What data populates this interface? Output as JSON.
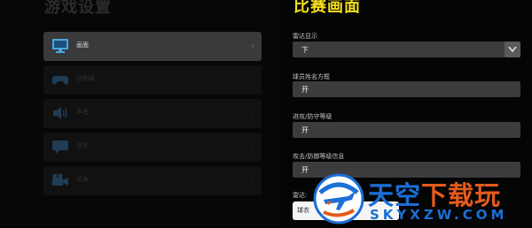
{
  "left_panel": {
    "title": "游戏设置",
    "items": [
      {
        "label": "画面",
        "icon": "monitor-icon",
        "active": true
      },
      {
        "label": "控制器",
        "icon": "gamepad-icon",
        "active": false
      },
      {
        "label": "声音",
        "icon": "speaker-icon",
        "active": false
      },
      {
        "label": "语言",
        "icon": "chat-bubble-icon",
        "active": false
      },
      {
        "label": "视角",
        "icon": "camera-icon",
        "active": false
      }
    ],
    "chevron": "›"
  },
  "right_panel": {
    "title": "比赛画面",
    "settings": [
      {
        "label": "雷达显示",
        "value": "下",
        "dropdown": true
      },
      {
        "label": "球员姓名方框",
        "value": "开"
      },
      {
        "label": "进攻/防守等级",
        "value": "开"
      },
      {
        "label": "攻击/防御等级信息",
        "value": "开"
      },
      {
        "label": "雷达:",
        "value": ""
      }
    ]
  },
  "popup": {
    "text": "球衣"
  },
  "watermark": {
    "main_part1": "天",
    "main_part2": "空",
    "main_part3": "下载玩",
    "sub": "SKYXZW.COM"
  },
  "colors": {
    "title_yellow": "#f3df1c",
    "active_item_bg": "#3a3a3c",
    "field_bg": "#3c3c3e",
    "watermark_blue": "#1b6fd6",
    "watermark_orange": "#e45b1c"
  }
}
